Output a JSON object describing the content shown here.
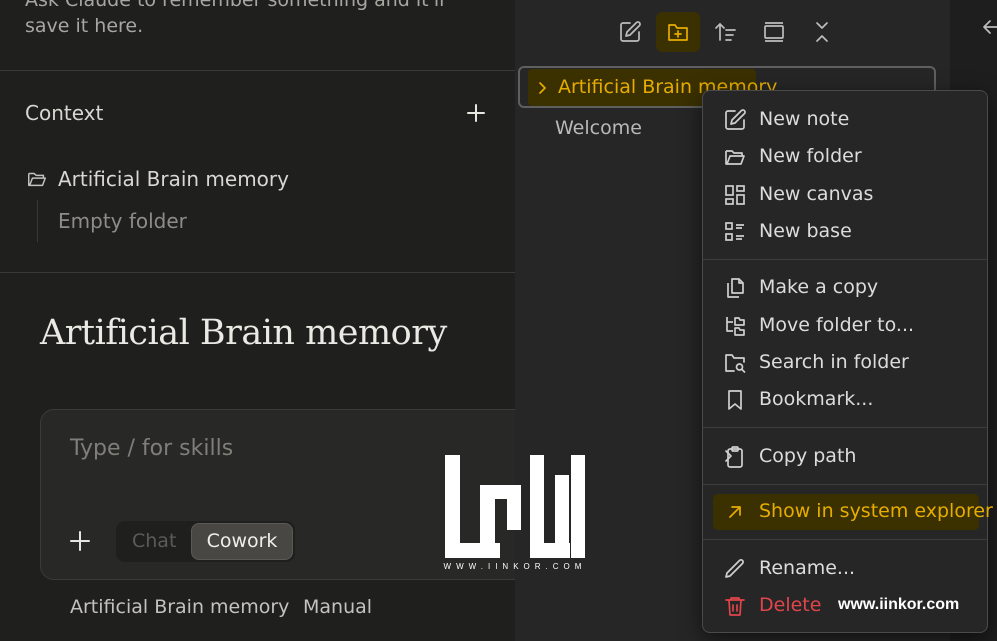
{
  "claude_panel": {
    "hint_text": "Ask Claude to remember something and it'll",
    "hint_text_2": "save it here.",
    "context": {
      "title": "Context",
      "add_icon": "plus-icon",
      "folder": {
        "icon": "folder-open-icon",
        "name": "Artificial Brain memory"
      },
      "empty_label": "Empty folder"
    },
    "page_title": "Artificial Brain memory",
    "composer": {
      "placeholder": "Type / for skills",
      "add_icon": "plus-icon",
      "modes": [
        "Chat",
        "Cowork"
      ],
      "active_mode": "Cowork"
    },
    "footer": {
      "project": "Artificial Brain memory",
      "mode": "Manual"
    }
  },
  "explorer": {
    "toolbar": [
      {
        "icon": "new-note-icon",
        "active": false
      },
      {
        "icon": "new-folder-icon",
        "active": true
      },
      {
        "icon": "sort-icon",
        "active": false
      },
      {
        "icon": "collapse-icon",
        "active": false
      },
      {
        "icon": "expand-collapse-icon",
        "active": false
      }
    ],
    "tree": [
      {
        "name": "Artificial Brain memory",
        "type": "folder",
        "selected": true,
        "icon": "chevron-right-icon"
      },
      {
        "name": "Welcome",
        "type": "note"
      }
    ]
  },
  "right_strip": {
    "icon": "arrow-left-icon"
  },
  "context_menu": {
    "items": [
      {
        "label": "New note",
        "icon": "edit-icon"
      },
      {
        "label": "New folder",
        "icon": "folder-open-icon"
      },
      {
        "label": "New canvas",
        "icon": "canvas-icon"
      },
      {
        "label": "New base",
        "icon": "base-table-icon"
      },
      {
        "label": "Make a copy",
        "icon": "copy-icon"
      },
      {
        "label": "Move folder to...",
        "icon": "move-folder-icon"
      },
      {
        "label": "Search in folder",
        "icon": "folder-search-icon"
      },
      {
        "label": "Bookmark...",
        "icon": "bookmark-icon"
      },
      {
        "label": "Copy path",
        "icon": "clipboard-icon",
        "submenu": true
      },
      {
        "label": "Show in system explorer",
        "icon": "arrow-up-right-icon",
        "highlighted": true
      },
      {
        "label": "Rename...",
        "icon": "pencil-icon"
      },
      {
        "label": "Delete",
        "icon": "trash-icon",
        "danger": true
      }
    ]
  },
  "colors": {
    "accent": "#e6ad00",
    "accent_bg": "#3a3000",
    "danger": "#e0454c",
    "claude_bg": "#1f1f1e",
    "explorer_bg": "#262626"
  },
  "watermark": {
    "url": "www.iinkor.com",
    "logo_caption": "WWW.IINKOR.COM"
  }
}
